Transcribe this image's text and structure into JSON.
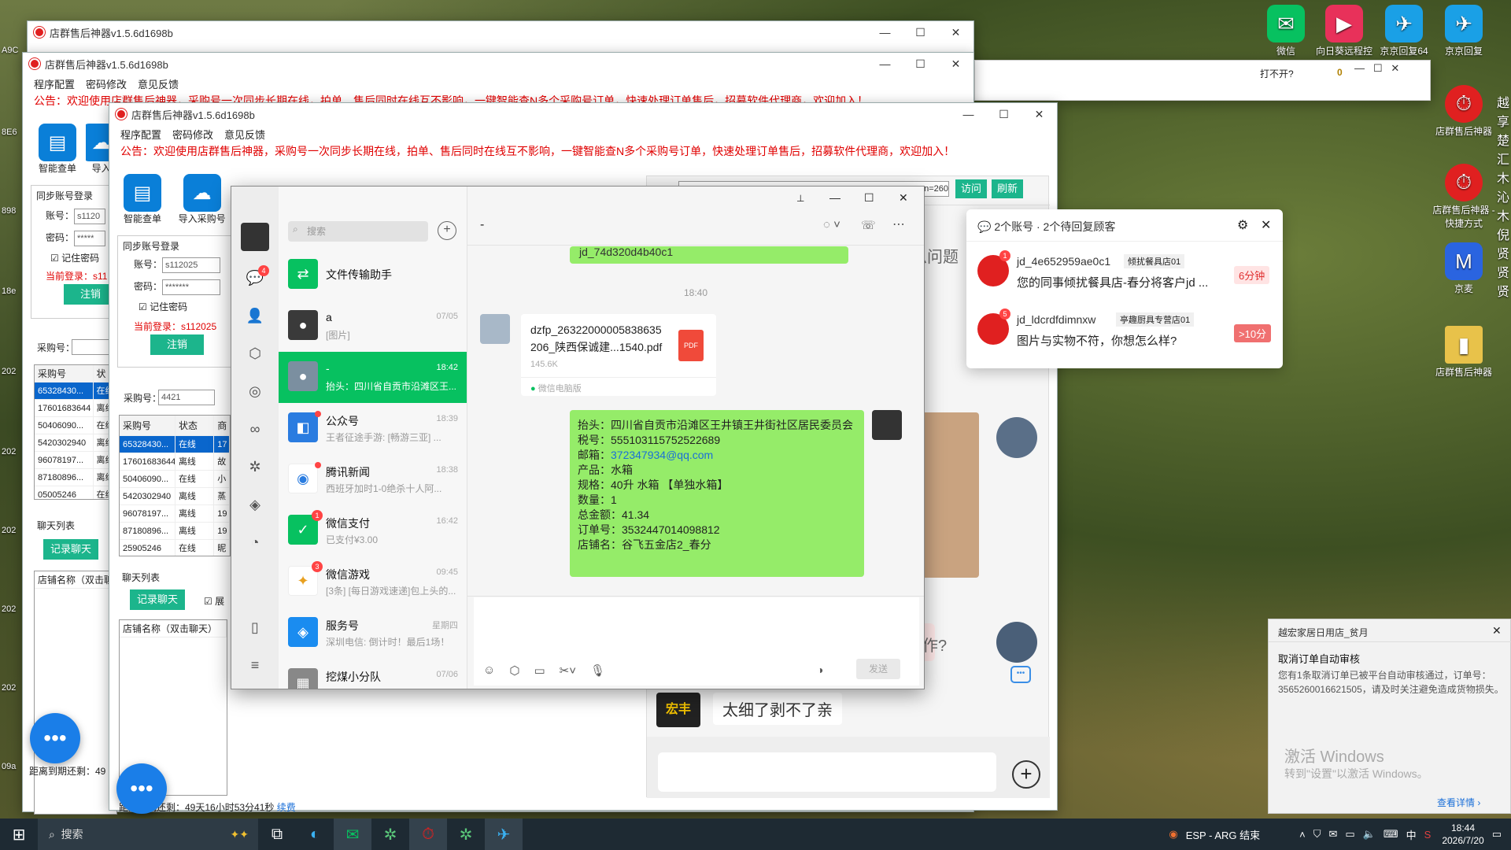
{
  "desktop": {
    "icons": [
      {
        "label": "微信",
        "icon": "wechat-icon",
        "color": "#07c160",
        "glyph": "✉"
      },
      {
        "label": "向日葵远程控",
        "icon": "sunflower-remote-icon",
        "color": "#e8315a",
        "glyph": "▶"
      },
      {
        "label": "京京回复64",
        "icon": "jd-reply-icon",
        "color": "#1aa0e6",
        "glyph": "✈"
      },
      {
        "label": "京京回复",
        "icon": "jd-reply-icon",
        "color": "#1aa0e6",
        "glyph": "✈"
      },
      {
        "label": "店群售后神器",
        "icon": "store-aftersale-icon",
        "color": "#e02020",
        "glyph": "⏱"
      },
      {
        "label": "店群售后神器 - 快捷方式",
        "icon": "store-aftersale-shortcut-icon",
        "color": "#e02020",
        "glyph": "⏱"
      },
      {
        "label": "京麦",
        "icon": "jingmai-icon",
        "color": "#2a64e0",
        "glyph": "M"
      },
      {
        "label": "店群售后神器",
        "icon": "folder-icon",
        "color": "#e8c24a",
        "glyph": "▮"
      }
    ],
    "left_edge_labels": [
      "A9C",
      "8E6",
      "898",
      "18e",
      "202",
      "202",
      "202",
      "202",
      "202",
      "09a"
    ],
    "right_edge_chars": [
      "越",
      "享",
      "楚",
      "汇",
      "木",
      "沁",
      "木",
      "倪",
      "贤",
      "贤",
      "贤"
    ]
  },
  "bg_window": {
    "title": "店群售后神器v1.5.6d1698b",
    "small_window_title": "打不开?",
    "small_window_value": "0"
  },
  "app_window_2": {
    "title": "店群售后神器v1.5.6d1698b",
    "menu": [
      "程序配置",
      "密码修改",
      "意见反馈"
    ],
    "notice": "公告：欢迎使用店群售后神器，采购号一次同步长期在线，拍单、售后同时在线互不影响，一键智能查N多个采购号订单，快速处理订单售后，招募软件代理商，欢迎加入！",
    "toolbar": [
      "智能查单",
      "导入"
    ],
    "sync_group": "同步账号登录",
    "account_label": "账号：",
    "account_value": "s1120",
    "password_label": "密码：",
    "password_value": "*****",
    "remember": "记住密码",
    "current_login": "当前登录：s11",
    "logout": "注销",
    "purchase_label": "采购号：",
    "table_headers": [
      "采购号",
      "状"
    ],
    "rows": [
      [
        "65328430...",
        "在线"
      ],
      [
        "17601683644",
        "离线"
      ],
      [
        "50406090...",
        "在线"
      ],
      [
        "5420302940",
        "离线"
      ],
      [
        "96078197...",
        "离线"
      ],
      [
        "87180896...",
        "离线"
      ],
      [
        "05005246",
        "在线"
      ]
    ],
    "chat_list_label": "聊天列表",
    "record_chat": "记录聊天",
    "shop_name_col": "店铺名称（双击聊",
    "expire_label": "距离到期还剩：49"
  },
  "app_window_3": {
    "title": "店群售后神器v1.5.6d1698b",
    "menu": [
      "程序配置",
      "密码修改",
      "意见反馈"
    ],
    "notice": "公告：欢迎使用店群售后神器，采购号一次同步长期在线，拍单、售后同时在线互不影响，一键智能查N多个采购号订单，快速处理订单售后，招募软件代理商，欢迎加入！",
    "toolbar": [
      "智能查单",
      "导入采购号"
    ],
    "sync_group": "同步账号登录",
    "account_label": "账号：",
    "account_value": "s112025",
    "password_label": "密码：",
    "password_value": "*******",
    "remember": "记住密码",
    "current_login": "当前登录：s112025",
    "logout": "注销",
    "purchase_label": "采购号：",
    "purchase_value": "4421",
    "table_headers": [
      "采购号",
      "状态",
      "商"
    ],
    "rows": [
      [
        "65328430...",
        "在线",
        "17"
      ],
      [
        "17601683644",
        "离线",
        "故"
      ],
      [
        "50406090...",
        "在线",
        "小"
      ],
      [
        "5420302940",
        "离线",
        "蒸"
      ],
      [
        "96078197...",
        "离线",
        "19"
      ],
      [
        "87180896...",
        "离线",
        "19"
      ],
      [
        "25905246",
        "在线",
        "昵"
      ]
    ],
    "chat_list_label": "聊天列表",
    "record_chat": "记录聊天",
    "show_label": "展",
    "shop_name_col": "店铺名称（双击聊天）",
    "expire_label": "距离到期还剩：49天16小时53分41秒",
    "renew_link": "续费",
    "url_fragment": "_sn=260",
    "visit_btn": "访问",
    "refresh_btn": "刷新",
    "chat_partial_1": "么问题",
    "chat_partial_2": "操作?",
    "chat_last_msg": "太细了剥不了亲",
    "shop_logo_text": "宏丰"
  },
  "wechat": {
    "search_placeholder": "搜索",
    "sidebar_badge": "4",
    "chats": [
      {
        "name": "文件传输助手",
        "preview": "",
        "time": "",
        "icon": "file-transfer-icon",
        "color": "#07c160",
        "glyph": "⇄"
      },
      {
        "name": "a",
        "preview": "[图片]",
        "time": "07/05",
        "icon": "avatar",
        "color": "#3a3a3a",
        "glyph": "●"
      },
      {
        "name": "-",
        "preview": "抬头：四川省自贡市沿滩区王...",
        "time": "18:42",
        "icon": "avatar",
        "color": "#7b8fa0",
        "glyph": "●",
        "active": true
      },
      {
        "name": "公众号",
        "preview": "王者征途手游: [畅游三亚] ...",
        "time": "18:39",
        "icon": "official-accounts-icon",
        "color": "#2a7ce0",
        "glyph": "◧",
        "dot": true
      },
      {
        "name": "腾讯新闻",
        "preview": "西班牙加时1-0绝杀十人阿...",
        "time": "18:38",
        "icon": "tencent-news-icon",
        "color": "#ffffff",
        "glyph": "◉",
        "dot": true
      },
      {
        "name": "微信支付",
        "preview": "已支付¥3.00",
        "time": "16:42",
        "icon": "wechat-pay-icon",
        "color": "#07c160",
        "glyph": "✓",
        "badge": "1"
      },
      {
        "name": "微信游戏",
        "preview": "[3条] [每日游戏速递]包上头的...",
        "time": "09:45",
        "icon": "wechat-games-icon",
        "color": "#ffffff",
        "glyph": "✦",
        "badge": "3"
      },
      {
        "name": "服务号",
        "preview": "深圳电信: 倒计时！最后1场！",
        "time": "星期四",
        "icon": "service-accounts-icon",
        "color": "#1a8cf0",
        "glyph": "◈"
      },
      {
        "name": "挖煤小分队",
        "preview": "",
        "time": "07/06",
        "icon": "group-avatar",
        "color": "#888888",
        "glyph": "▦"
      }
    ],
    "chat_title": "-",
    "prev_bubble_fragment": "jd_74d320d4b40c1",
    "time_divider": "18:40",
    "file_name_1": "dzfp_26322000005838635",
    "file_name_2": "206_陕西保诚建...1540.pdf",
    "file_size": "145.6K",
    "file_source": "微信电脑版",
    "pdf_label": "PDF",
    "order_lines": [
      {
        "label": "抬头：",
        "value": "四川省自贡市沿滩区王井镇王井街社区居民委员会"
      },
      {
        "label": "税号：",
        "value": "555103115752522689"
      },
      {
        "label": "邮箱：",
        "value": "372347934@qq.com",
        "link": true
      },
      {
        "label": "产品：",
        "value": "水箱"
      },
      {
        "label": "规格：",
        "value": "40升 水箱 【单独水箱】"
      },
      {
        "label": "数量：",
        "value": "1"
      },
      {
        "label": "总金额：",
        "value": "41.34"
      },
      {
        "label": "订单号：",
        "value": "3532447014098812"
      },
      {
        "label": "店铺名：",
        "value": "谷飞五金店2_春分"
      }
    ],
    "send_label": "发送"
  },
  "popup": {
    "header": "2个账号 · 2个待回复顾客",
    "items": [
      {
        "user": "jd_4e652959ae0c1",
        "shop": "倾扰餐具店01",
        "msg": "您的同事倾扰餐具店-春分将客户jd ...",
        "time": "6分钟",
        "badge": "1"
      },
      {
        "user": "jd_ldcrdfdimnxw",
        "shop": "亭趣厨具专营店01",
        "msg": "图片与实物不符，你想怎么样?",
        "time": ">10分",
        "badge": "5"
      }
    ]
  },
  "notification": {
    "source": "越宏家居日用店_贫月",
    "title": "取消订单自动审核",
    "body": "您有1条取消订单已被平台自动审核通过，订单号：3565260016621505，请及时关注避免造成货物损失。",
    "activate_title": "激活 Windows",
    "activate_sub": "转到\"设置\"以激活 Windows。",
    "details": "查看详情"
  },
  "taskbar": {
    "search": "搜索",
    "lang": "ESP - ARG 结束",
    "ime": "中",
    "time": "18:44",
    "date": "2026/7/20"
  },
  "colors": {
    "wechat_green": "#07c160",
    "bubble_green": "#95ec69",
    "notice_red": "#e00000",
    "app_green_btn": "#1cb58c",
    "selected_row": "#0a66cc"
  }
}
